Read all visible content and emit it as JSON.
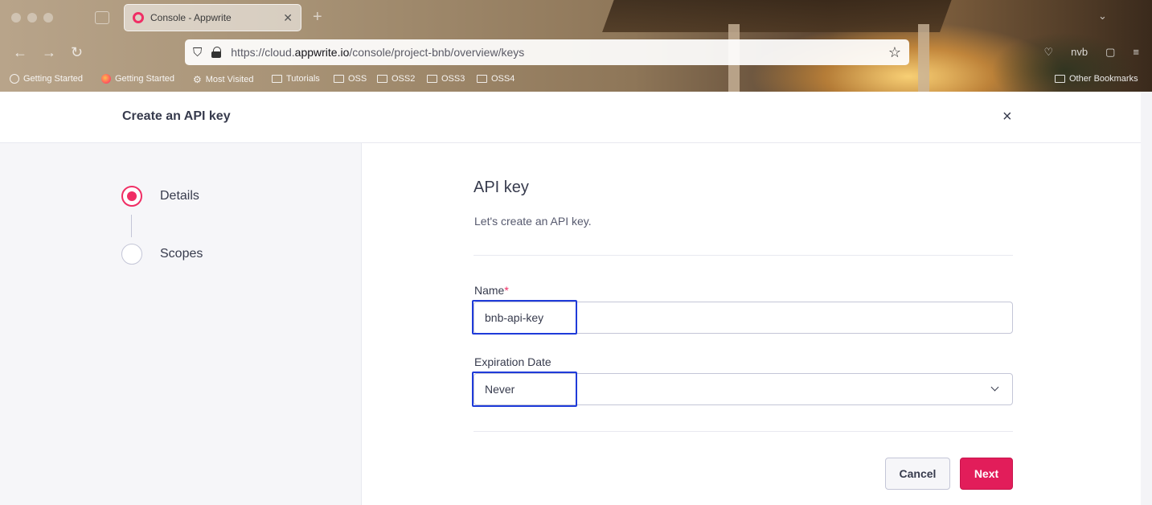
{
  "browser": {
    "tab_title": "Console - Appwrite",
    "url_prefix": "https://cloud.",
    "url_domain": "appwrite.io",
    "url_path": "/console/project-bnb/overview/keys",
    "bookmarks": [
      "Getting Started",
      "Getting Started",
      "Most Visited",
      "Tutorials",
      "OSS",
      "OSS2",
      "OSS3",
      "OSS4"
    ],
    "other_bookmarks": "Other Bookmarks",
    "profile_initials": "nvb"
  },
  "modal": {
    "title": "Create an API key",
    "close_glyph": "×"
  },
  "steps": [
    {
      "label": "Details",
      "active": true
    },
    {
      "label": "Scopes",
      "active": false
    }
  ],
  "form": {
    "title": "API key",
    "description": "Let's create an API key.",
    "name_label": "Name",
    "required_marker": "*",
    "name_value": "bnb-api-key",
    "expiration_label": "Expiration Date",
    "expiration_value": "Never",
    "cancel_label": "Cancel",
    "next_label": "Next"
  },
  "colors": {
    "accent": "#f02e65",
    "primary_button": "#e21d5a",
    "highlight_box": "#1f3bd9"
  }
}
